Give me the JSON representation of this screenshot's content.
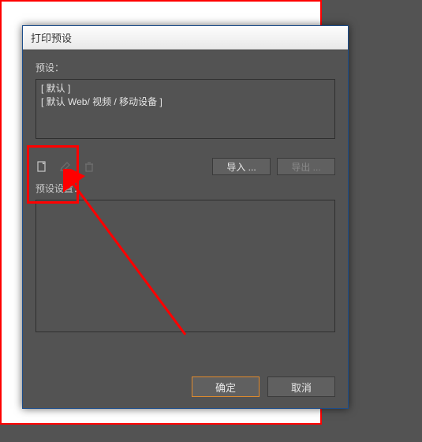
{
  "dialog": {
    "title": "打印预设",
    "preset_label": "预设：",
    "preset_items": [
      "[ 默认 ]",
      "[ 默认 Web/ 视频 / 移动设备 ]"
    ],
    "import_label": "导入 ...",
    "export_label": "导出 ...",
    "settings_label": "预设设置：",
    "ok_label": "确定",
    "cancel_label": "取消"
  }
}
